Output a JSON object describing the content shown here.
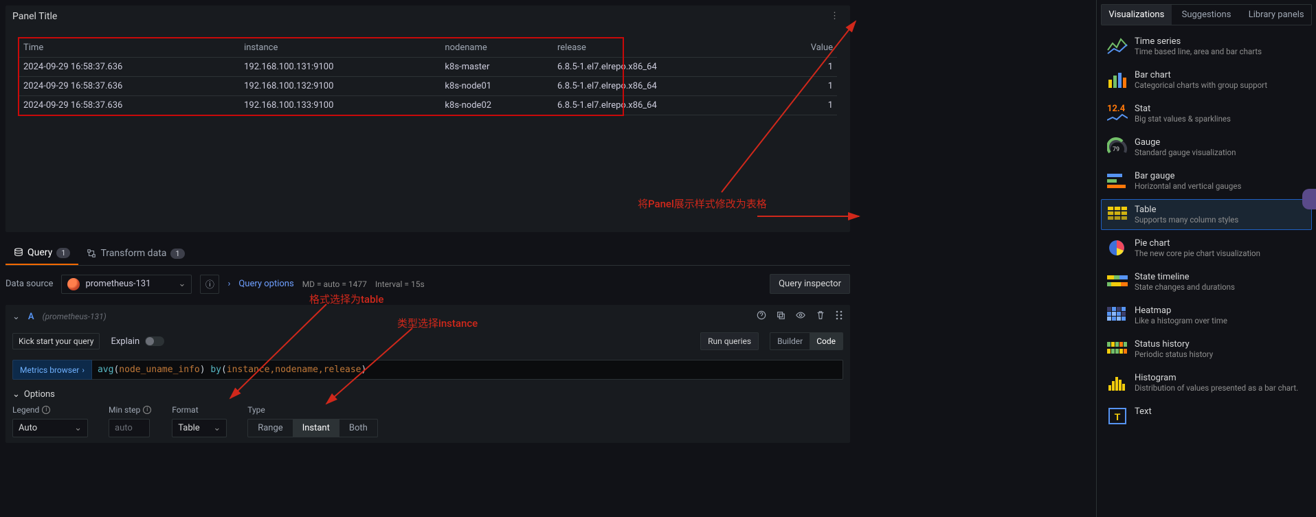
{
  "panel": {
    "title": "Panel Title"
  },
  "table": {
    "headers": {
      "time": "Time",
      "instance": "instance",
      "nodename": "nodename",
      "release": "release",
      "value": "Value"
    },
    "rows": [
      {
        "time": "2024-09-29 16:58:37.636",
        "instance": "192.168.100.131:9100",
        "nodename": "k8s-master",
        "release": "6.8.5-1.el7.elrepo.x86_64",
        "value": "1"
      },
      {
        "time": "2024-09-29 16:58:37.636",
        "instance": "192.168.100.132:9100",
        "nodename": "k8s-node01",
        "release": "6.8.5-1.el7.elrepo.x86_64",
        "value": "1"
      },
      {
        "time": "2024-09-29 16:58:37.636",
        "instance": "192.168.100.133:9100",
        "nodename": "k8s-node02",
        "release": "6.8.5-1.el7.elrepo.x86_64",
        "value": "1"
      }
    ]
  },
  "annotations": {
    "a1": "将Panel展示样式修改为表格",
    "a2": "格式选择为table",
    "a3": "类型选择instance"
  },
  "tabs": {
    "query": "Query",
    "query_badge": "1",
    "transform": "Transform data",
    "transform_badge": "1"
  },
  "datasource": {
    "label": "Data source",
    "selected": "prometheus-131",
    "query_options": "Query options",
    "meta_md": "MD = auto = 1477",
    "meta_interval": "Interval = 15s",
    "inspector": "Query inspector"
  },
  "query": {
    "letter": "A",
    "src": "(prometheus-131)",
    "kick": "Kick start your query",
    "explain": "Explain",
    "run": "Run queries",
    "mode_builder": "Builder",
    "mode_code": "Code",
    "metrics_browser": "Metrics browser",
    "expr_fn": "avg",
    "expr_id1": "node_uname_info",
    "expr_by": "by",
    "expr_args": "instance,nodename,release",
    "options": "Options",
    "legend_label": "Legend",
    "legend_value": "Auto",
    "minstep_label": "Min step",
    "minstep_ph": "auto",
    "format_label": "Format",
    "format_value": "Table",
    "type_label": "Type",
    "type_range": "Range",
    "type_instant": "Instant",
    "type_both": "Both"
  },
  "side": {
    "tab_viz": "Visualizations",
    "tab_sugg": "Suggestions",
    "tab_lib": "Library panels",
    "items": [
      {
        "name": "Time series",
        "desc": "Time based line, area and bar charts"
      },
      {
        "name": "Bar chart",
        "desc": "Categorical charts with group support"
      },
      {
        "name": "Stat",
        "desc": "Big stat values & sparklines"
      },
      {
        "name": "Gauge",
        "desc": "Standard gauge visualization"
      },
      {
        "name": "Bar gauge",
        "desc": "Horizontal and vertical gauges"
      },
      {
        "name": "Table",
        "desc": "Supports many column styles"
      },
      {
        "name": "Pie chart",
        "desc": "The new core pie chart visualization"
      },
      {
        "name": "State timeline",
        "desc": "State changes and durations"
      },
      {
        "name": "Heatmap",
        "desc": "Like a histogram over time"
      },
      {
        "name": "Status history",
        "desc": "Periodic status history"
      },
      {
        "name": "Histogram",
        "desc": "Distribution of values presented as a bar chart."
      },
      {
        "name": "Text",
        "desc": ""
      }
    ],
    "stat_number": "12.4",
    "gauge_number": "79"
  }
}
